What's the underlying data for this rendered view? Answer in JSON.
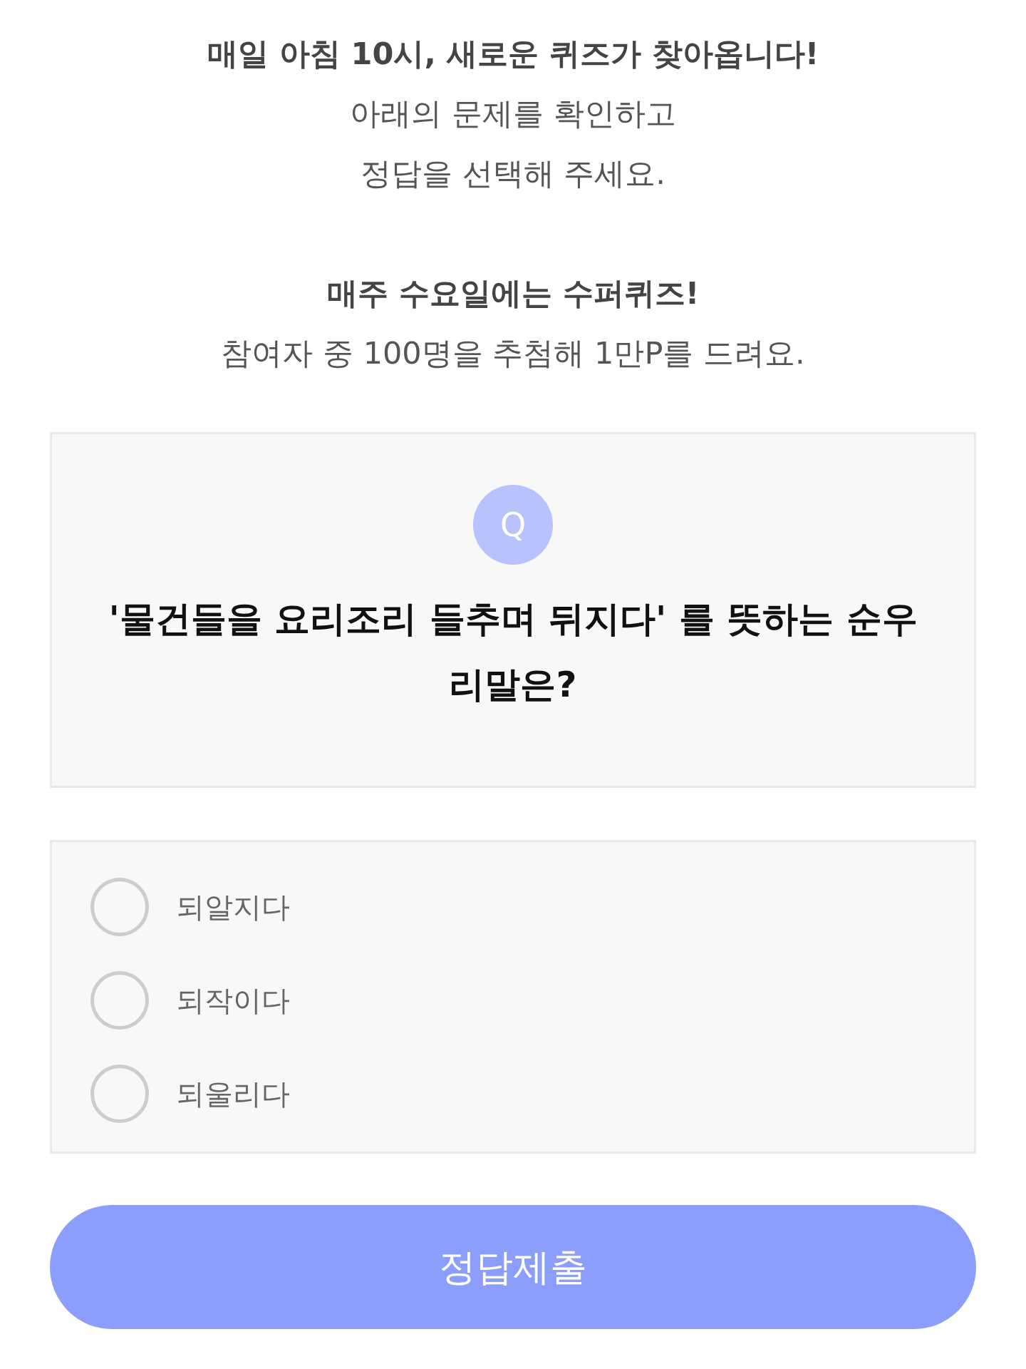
{
  "intro": {
    "headline": "매일 아침 10시, 새로운 퀴즈가 찾아옵니다!",
    "lines": [
      "아래의 문제를 확인하고",
      "정답을 선택해 주세요."
    ]
  },
  "notice": {
    "headline": "매주 수요일에는 수퍼퀴즈!",
    "lines": [
      "참여자 중 100명을 추첨해 1만P를 드려요."
    ]
  },
  "question": {
    "badge": "Q",
    "text": "'물건들을 요리조리 들추며 뒤지다' 를 뜻하는 순우리말은?"
  },
  "options": [
    {
      "label": "되알지다",
      "selected": false
    },
    {
      "label": "되작이다",
      "selected": false
    },
    {
      "label": "되울리다",
      "selected": false
    }
  ],
  "submit_button": {
    "label": "정답제출"
  }
}
